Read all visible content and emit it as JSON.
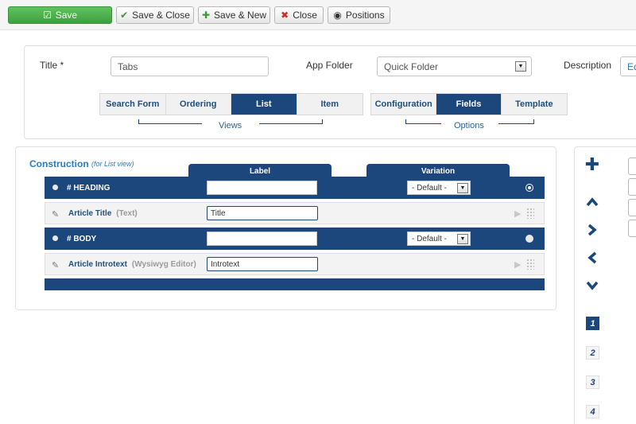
{
  "toolbar": {
    "save": "Save",
    "save_close": "Save & Close",
    "save_new": "Save & New",
    "close": "Close",
    "positions": "Positions"
  },
  "form": {
    "title_label": "Title *",
    "title_value": "Tabs",
    "app_folder_label": "App Folder",
    "app_folder_value": "Quick Folder",
    "description_label": "Description",
    "description_partial": "Ed"
  },
  "views": {
    "label": "Views",
    "tabs": [
      "Search Form",
      "Ordering",
      "List",
      "Item"
    ],
    "active": "List"
  },
  "options": {
    "label": "Options",
    "tabs": [
      "Configuration",
      "Fields",
      "Template"
    ],
    "active": "Fields"
  },
  "construction": {
    "title": "Construction",
    "subtitle": "(for List view)",
    "columns": {
      "label": "Label",
      "variation": "Variation"
    },
    "rows": [
      {
        "name": "# HEADING",
        "label": "",
        "variation": "- Default -"
      },
      {
        "name": "Article Title",
        "type": "(Text)",
        "label": "Title"
      },
      {
        "name": "# BODY",
        "label": "",
        "variation": "- Default -"
      },
      {
        "name": "Article Introtext",
        "type": "(Wysiwyg Editor)",
        "label": "Introtext"
      }
    ]
  },
  "sidebar": {
    "icons": [
      "plus-icon",
      "chevron-up-icon",
      "chevron-right-icon",
      "chevron-left-icon",
      "chevron-down-icon"
    ],
    "pages": [
      "1",
      "2",
      "3",
      "4"
    ],
    "active_page": "1"
  },
  "colors": {
    "accent": "#1c477c",
    "save_green": "#4cae4c",
    "link_blue": "#2a7bbd"
  }
}
